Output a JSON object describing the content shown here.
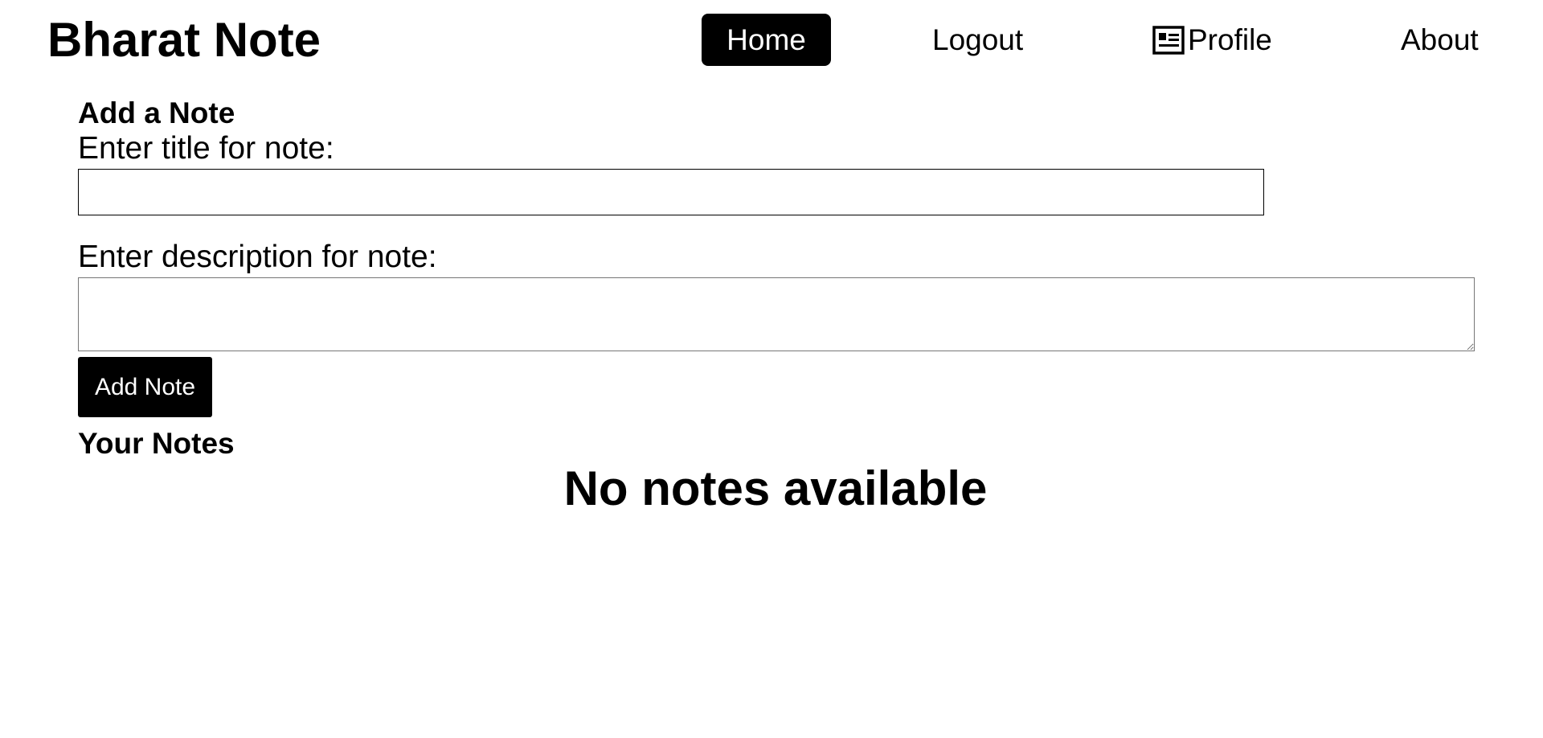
{
  "app": {
    "brand": "Bharat Note"
  },
  "nav": {
    "home": "Home",
    "logout": "Logout",
    "profile": "Profile",
    "profile_icon": "id-card-icon",
    "about": "About"
  },
  "form": {
    "heading": "Add a Note",
    "title_label": "Enter title for note:",
    "title_value": "",
    "title_placeholder": "",
    "description_label": "Enter description for note:",
    "description_value": "",
    "description_placeholder": "",
    "submit_label": "Add Note"
  },
  "notes": {
    "heading": "Your Notes",
    "empty_message": "No notes available",
    "items": []
  },
  "colors": {
    "primary": "#000000",
    "background": "#ffffff",
    "on_primary": "#ffffff"
  }
}
